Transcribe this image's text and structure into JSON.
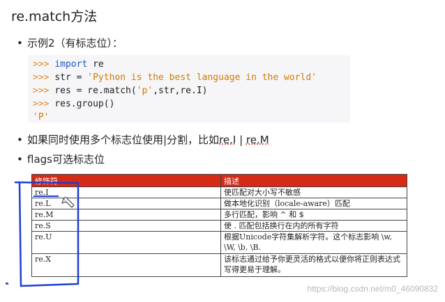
{
  "title": "re.match方法",
  "bullets": {
    "b1": "示例2（有标志位）：",
    "b2_prefix": "如果同时使用多个标志位使用|分割，比如",
    "b2_code1": "re.I",
    "b2_sep": " | ",
    "b2_code2": "re.M",
    "b3": "flags可选标志位"
  },
  "code": {
    "prompt": ">>>",
    "lines": [
      {
        "kw": "import",
        "rest": " re"
      },
      {
        "pre": "str = ",
        "str": "'Python is the best language in the world'"
      },
      {
        "pre": "res = re.match(",
        "str": "'p'",
        "post": ",str,re.I)"
      },
      {
        "pre": "res.group()"
      }
    ],
    "output": "'P'"
  },
  "table": {
    "header_color": "#d42a16",
    "headers": [
      "修饰符",
      "描述"
    ],
    "rows": [
      [
        "re.I",
        "使匹配对大小写不敏感"
      ],
      [
        "re.L",
        "做本地化识别（locale-aware）匹配"
      ],
      [
        "re.M",
        "多行匹配，影响 ^ 和 $"
      ],
      [
        "re.S",
        "使 . 匹配包括换行在内的所有字符"
      ],
      [
        "re.U",
        "根据Unicode字符集解析字符。这个标志影响 \\w, \\W, \\b, \\B."
      ],
      [
        "re.X",
        "该标志通过给予你更灵活的格式以便你将正则表达式写得更易于理解。"
      ]
    ]
  },
  "watermark": "https://blog.csdn.net/m0_46090832",
  "colors": {
    "annotation": "#1b3fd6",
    "code_bg": "#f6f6f8"
  }
}
